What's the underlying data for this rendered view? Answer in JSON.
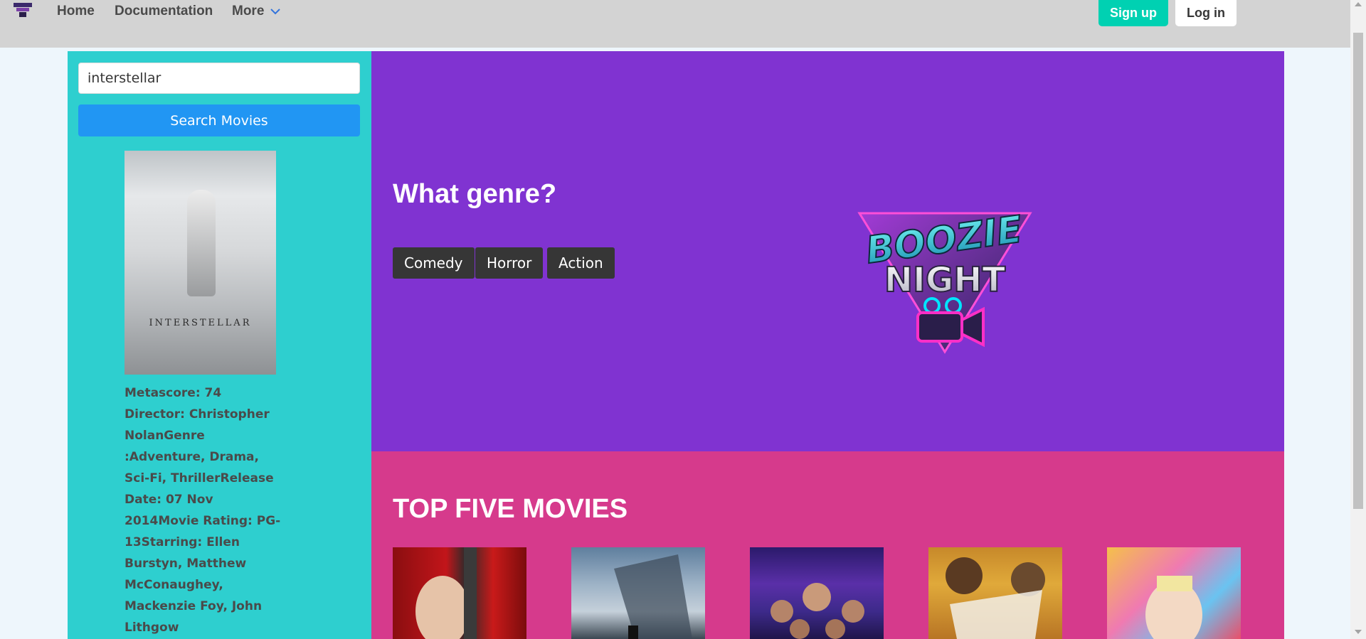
{
  "nav": {
    "home": "Home",
    "documentation": "Documentation",
    "more": "More",
    "signup": "Sign up",
    "login": "Log in"
  },
  "search": {
    "value": "interstellar",
    "button": "Search Movies"
  },
  "movie": {
    "poster_title": "INTERSTELLAR",
    "details": "Metascore: 74 Director: Christopher NolanGenre :Adventure, Drama, Sci-Fi, ThrillerRelease Date: 07 Nov 2014Movie Rating: PG-13Starring: Ellen Burstyn, Matthew McConaughey, Mackenzie Foy, John Lithgow"
  },
  "hero": {
    "title": "What genre?",
    "genres": [
      "Comedy",
      "Horror",
      "Action"
    ],
    "logo_text": [
      "BOOZIE",
      "NIGHT"
    ]
  },
  "top_five": {
    "title": "TOP FIVE MOVIES"
  },
  "colors": {
    "navbar": "#d3d3d3",
    "left_panel": "#2ecfcf",
    "hero": "#8033d1",
    "top_five": "#d63a8c",
    "signup": "#00d1b2",
    "search_button": "#2196f3"
  }
}
